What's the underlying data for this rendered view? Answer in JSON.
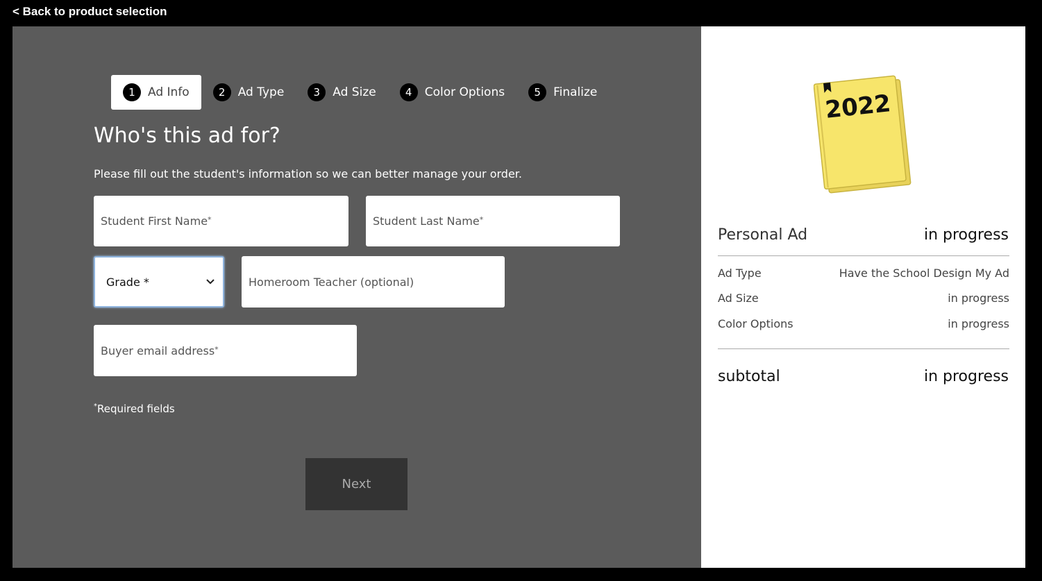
{
  "nav": {
    "back_label": "< Back to product selection"
  },
  "stepper": {
    "steps": [
      {
        "num": "1",
        "label": "Ad Info"
      },
      {
        "num": "2",
        "label": "Ad Type"
      },
      {
        "num": "3",
        "label": "Ad Size"
      },
      {
        "num": "4",
        "label": "Color Options"
      },
      {
        "num": "5",
        "label": "Finalize"
      }
    ],
    "active_index": 0
  },
  "form": {
    "heading": "Who's this ad for?",
    "subtext": "Please fill out the student's information so we can better manage your order.",
    "first_name_placeholder": "Student First Name",
    "last_name_placeholder": "Student Last Name",
    "grade_selected": "Grade *",
    "teacher_placeholder": "Homeroom Teacher (optional)",
    "email_placeholder": "Buyer email address",
    "required_marker": "*",
    "required_note": "Required fields",
    "next_label": "Next"
  },
  "summary": {
    "book_year": "2022",
    "title": "Personal Ad",
    "title_status": "in progress",
    "rows": [
      {
        "label": "Ad Type",
        "value": "Have the School Design My Ad"
      },
      {
        "label": "Ad Size",
        "value": "in progress"
      },
      {
        "label": "Color Options",
        "value": "in progress"
      }
    ],
    "subtotal_label": "subtotal",
    "subtotal_value": "in progress"
  },
  "colors": {
    "left_panel": "#5b5b5b",
    "book_yellow": "#f7e56b",
    "step_badge": "#000000"
  },
  "icons": {
    "grade_dropdown": "chevron-down-icon",
    "book": "yearbook-icon"
  }
}
